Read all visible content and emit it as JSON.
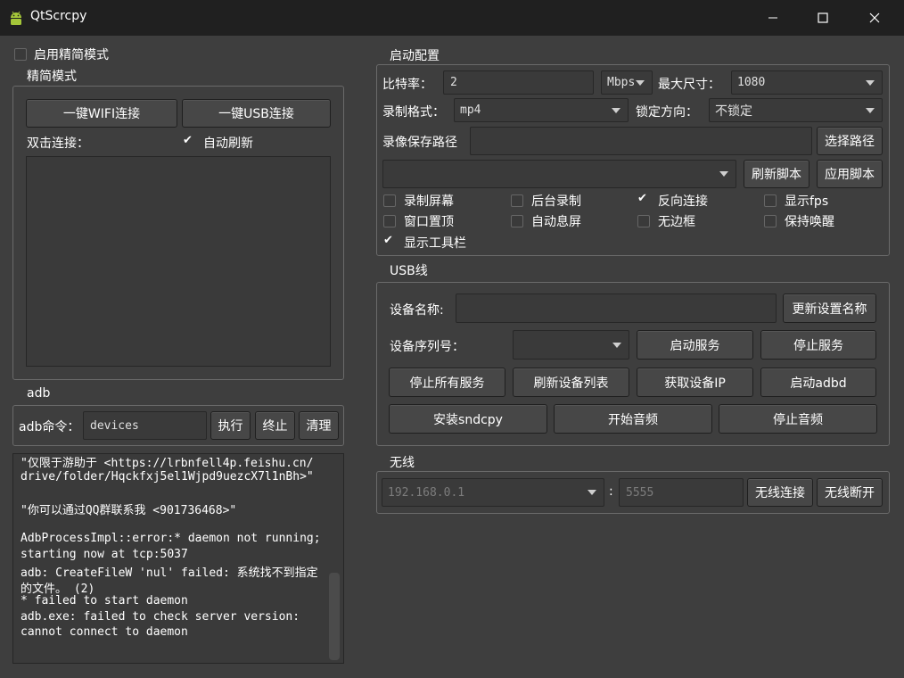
{
  "window": {
    "title": "QtScrcpy",
    "minimize": "—",
    "maximize": "☐",
    "close": "✕"
  },
  "simple_mode": {
    "enable_label": "启用精简模式",
    "group_title": "精简模式",
    "wifi_button": "一键WIFI连接",
    "usb_button": "一键USB连接",
    "double_click_label": "双击连接：",
    "auto_refresh_label": "自动刷新",
    "auto_refresh_checked": true
  },
  "adb": {
    "group_title": "adb",
    "command_label": "adb命令：",
    "command_value": "devices",
    "run_button": "执行",
    "stop_button": "终止",
    "clear_button": "清理",
    "log_lines": [
      "\"仅限于游助于 <https://lrbnfell4p.feishu.cn/",
      "drive/folder/Hqckfxj5el1Wjpd9uezcX7l1nBh>\"",
      "",
      "\"你可以通过QQ群联系我 <901736468>\"",
      "",
      "AdbProcessImpl::error:* daemon not running;",
      "starting now at tcp:5037",
      "adb: CreateFileW 'nul' failed: 系统找不到指定",
      "的文件。 (2)",
      "* failed to start daemon",
      "adb.exe: failed to check server version:",
      "cannot connect to daemon"
    ]
  },
  "start_config": {
    "group_title": "启动配置",
    "bitrate_label": "比特率：",
    "bitrate_value": "2",
    "bitrate_unit": "Mbps",
    "max_size_label": "最大尺寸：",
    "max_size_value": "1080",
    "record_format_label": "录制格式：",
    "record_format_value": "mp4",
    "lock_orientation_label": "锁定方向：",
    "lock_orientation_value": "不锁定",
    "record_path_label": "录像保存路径",
    "record_path_value": "",
    "choose_path_button": "选择路径",
    "script_value": "",
    "refresh_script_button": "刷新脚本",
    "apply_script_button": "应用脚本",
    "options": [
      {
        "label": "录制屏幕",
        "checked": false
      },
      {
        "label": "后台录制",
        "checked": false
      },
      {
        "label": "反向连接",
        "checked": true
      },
      {
        "label": "显示fps",
        "checked": false
      },
      {
        "label": "窗口置顶",
        "checked": false
      },
      {
        "label": "自动息屏",
        "checked": false
      },
      {
        "label": "无边框",
        "checked": false
      },
      {
        "label": "保持唤醒",
        "checked": false
      },
      {
        "label": "显示工具栏",
        "checked": true
      }
    ]
  },
  "usb": {
    "group_title": "USB线",
    "device_name_label": "设备名称:",
    "device_name_value": "",
    "update_name_button": "更新设置名称",
    "serial_label": "设备序列号：",
    "serial_value": "",
    "start_service_button": "启动服务",
    "stop_service_button": "停止服务",
    "stop_all_button": "停止所有服务",
    "refresh_list_button": "刷新设备列表",
    "get_ip_button": "获取设备IP",
    "start_adbd_button": "启动adbd",
    "install_sndcpy_button": "安装sndcpy",
    "start_audio_button": "开始音频",
    "stop_audio_button": "停止音频"
  },
  "wireless": {
    "group_title": "无线",
    "ip_placeholder": "192.168.0.1",
    "colon": ":",
    "port_placeholder": "5555",
    "connect_button": "无线连接",
    "disconnect_button": "无线断开"
  }
}
